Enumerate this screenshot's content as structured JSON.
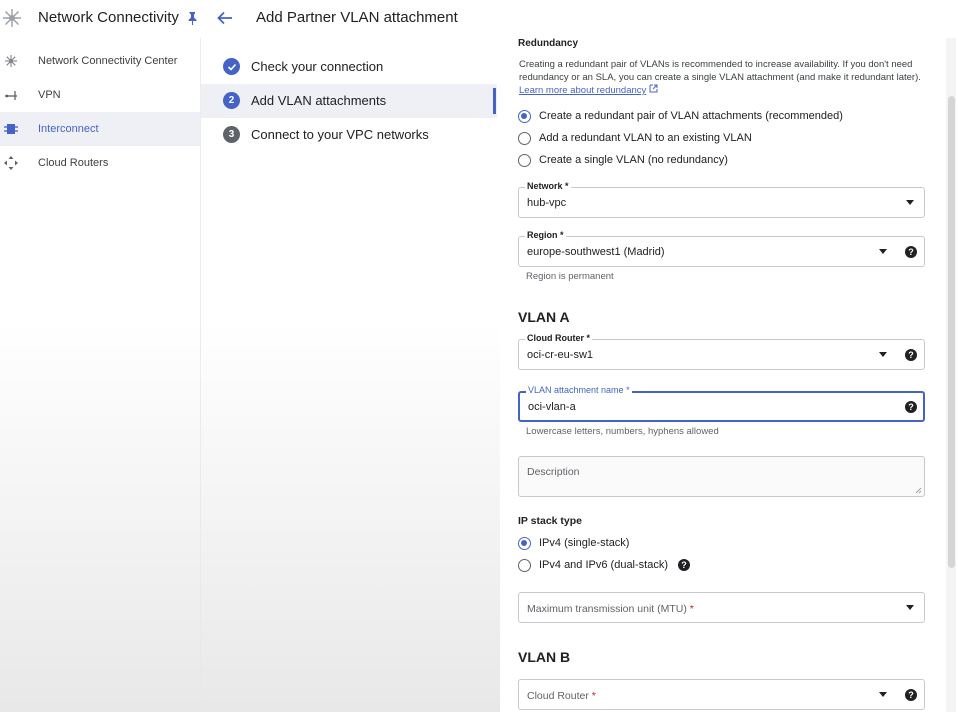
{
  "header": {
    "product_title": "Network Connectivity",
    "page_title": "Add Partner VLAN attachment"
  },
  "leftnav": {
    "items": [
      {
        "label": "Network Connectivity Center",
        "icon": "hub-icon"
      },
      {
        "label": "VPN",
        "icon": "vpn-icon"
      },
      {
        "label": "Interconnect",
        "icon": "interconnect-icon",
        "active": true
      },
      {
        "label": "Cloud Routers",
        "icon": "router-icon"
      }
    ]
  },
  "steps": [
    {
      "badge": "✓",
      "label": "Check your connection",
      "state": "done"
    },
    {
      "badge": "2",
      "label": "Add VLAN attachments",
      "state": "active"
    },
    {
      "badge": "3",
      "label": "Connect to your VPC networks",
      "state": "pending"
    }
  ],
  "form": {
    "redundancy": {
      "heading": "Redundancy",
      "info": "Creating a redundant pair of VLANs is recommended to increase availability. If you don't need redundancy or an SLA, you can create a single VLAN attachment (and make it redundant later).",
      "link": "Learn more about redundancy",
      "options": [
        {
          "label": "Create a redundant pair of VLAN attachments (recommended)",
          "checked": true
        },
        {
          "label": "Add a redundant VLAN to an existing VLAN",
          "checked": false
        },
        {
          "label": "Create a single VLAN (no redundancy)",
          "checked": false
        }
      ]
    },
    "network": {
      "label": "Network",
      "value": "hub-vpc"
    },
    "region": {
      "label": "Region",
      "value": "europe-southwest1 (Madrid)",
      "hint": "Region is permanent"
    },
    "vlan_a": {
      "heading": "VLAN A",
      "cloud_router": {
        "label": "Cloud Router",
        "value": "oci-cr-eu-sw1"
      },
      "attachment_name": {
        "label": "VLAN attachment name",
        "value": "oci-vlan-a",
        "hint": "Lowercase letters, numbers, hyphens allowed"
      },
      "description": {
        "placeholder": "Description"
      },
      "ip_stack": {
        "heading": "IP stack type",
        "options": [
          {
            "label": "IPv4 (single-stack)",
            "checked": true
          },
          {
            "label": "IPv4 and IPv6 (dual-stack)",
            "checked": false
          }
        ]
      },
      "mtu": {
        "placeholder": "Maximum transmission unit (MTU)"
      }
    },
    "vlan_b": {
      "heading": "VLAN B",
      "cloud_router": {
        "placeholder": "Cloud Router"
      }
    },
    "required_mark": "*",
    "help_glyph": "?"
  },
  "colors": {
    "accent": "#4563c4",
    "text": "#202124",
    "muted": "#5f6368",
    "required": "#c5221f"
  }
}
